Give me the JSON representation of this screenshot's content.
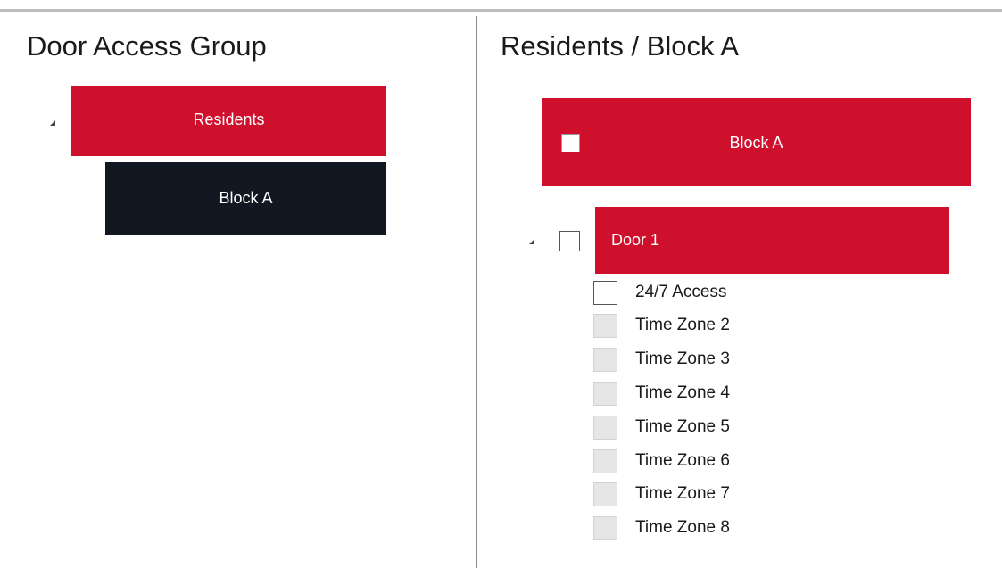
{
  "left_panel": {
    "title": "Door Access Group",
    "tree": [
      {
        "label": "Residents",
        "expanded": true
      },
      {
        "label": "Block A",
        "selected": true
      }
    ]
  },
  "right_panel": {
    "title": "Residents / Block A",
    "block": {
      "label": "Block A",
      "checked": false
    },
    "door": {
      "label": "Door 1",
      "checked": false,
      "expanded": true,
      "time_zones": [
        {
          "label": "24/7 Access",
          "enabled": true,
          "checked": false
        },
        {
          "label": "Time Zone 2",
          "enabled": false,
          "checked": false
        },
        {
          "label": "Time Zone 3",
          "enabled": false,
          "checked": false
        },
        {
          "label": "Time Zone 4",
          "enabled": false,
          "checked": false
        },
        {
          "label": "Time Zone 5",
          "enabled": false,
          "checked": false
        },
        {
          "label": "Time Zone 6",
          "enabled": false,
          "checked": false
        },
        {
          "label": "Time Zone 7",
          "enabled": false,
          "checked": false
        },
        {
          "label": "Time Zone 8",
          "enabled": false,
          "checked": false
        }
      ]
    }
  },
  "colors": {
    "accent_red": "#cf102d",
    "selected_dark": "#111821",
    "divider": "#8c8c8c",
    "disabled_checkbox": "#e6e6e6"
  },
  "icons": {
    "expander": "expanded-triangle-icon"
  }
}
